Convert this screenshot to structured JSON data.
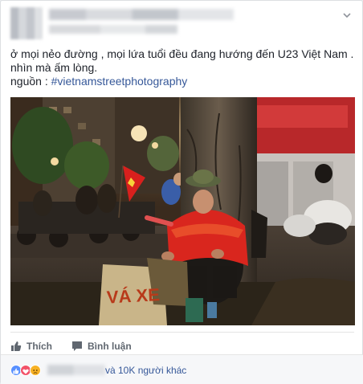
{
  "post": {
    "caption_lines": [
      "ở mọi nẻo đường , mọi lứa tuổi đều đang hướng đến U23 Việt Nam .",
      "nhìn mà ấm lòng."
    ],
    "source_label": "nguồn : ",
    "hashtag": "#vietnamstreetphotography"
  },
  "photo": {
    "sign_text": "VÁ XE"
  },
  "actions": {
    "like_label": "Thích",
    "comment_label": "Bình luận"
  },
  "reactions": {
    "summary_text": "và 10K người khác",
    "types": [
      "like-icon",
      "love-icon",
      "sad-icon"
    ]
  },
  "colors": {
    "link": "#365899",
    "action_text": "#606770",
    "like_blue": "#5890ff",
    "love_red": "#f25268",
    "sad_yellow": "#f7b125"
  }
}
